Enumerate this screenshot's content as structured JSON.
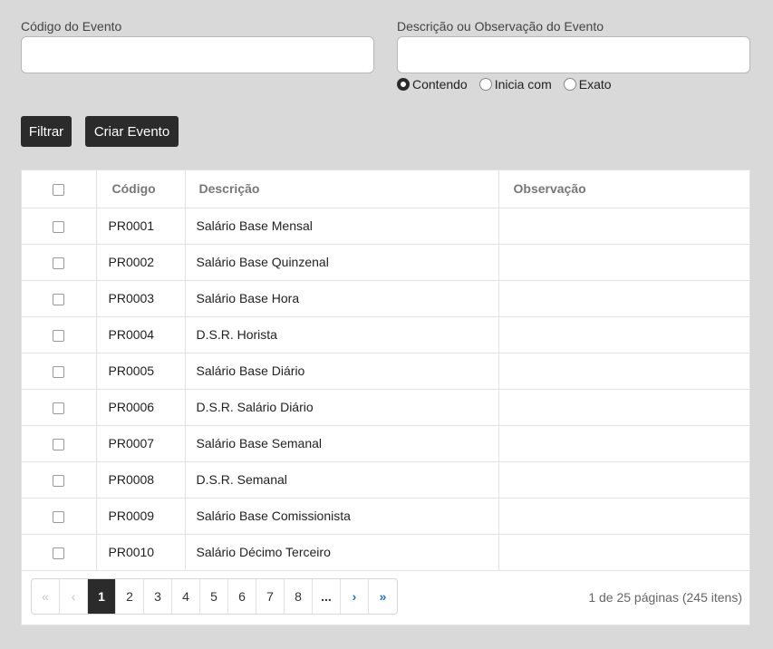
{
  "filters": {
    "code_label": "Código do Evento",
    "code_value": "",
    "desc_label": "Descrição ou Observação do Evento",
    "desc_value": "",
    "match_options": [
      {
        "label": "Contendo",
        "checked": true
      },
      {
        "label": "Inicia com",
        "checked": false
      },
      {
        "label": "Exato",
        "checked": false
      }
    ]
  },
  "buttons": {
    "filter_label": "Filtrar",
    "create_label": "Criar Evento"
  },
  "table": {
    "headers": {
      "code": "Código",
      "description": "Descrição",
      "observation": "Observação"
    },
    "rows": [
      {
        "code": "PR0001",
        "description": "Salário Base Mensal",
        "observation": ""
      },
      {
        "code": "PR0002",
        "description": "Salário Base Quinzenal",
        "observation": ""
      },
      {
        "code": "PR0003",
        "description": "Salário Base Hora",
        "observation": ""
      },
      {
        "code": "PR0004",
        "description": "D.S.R. Horista",
        "observation": ""
      },
      {
        "code": "PR0005",
        "description": "Salário Base Diário",
        "observation": ""
      },
      {
        "code": "PR0006",
        "description": "D.S.R. Salário Diário",
        "observation": ""
      },
      {
        "code": "PR0007",
        "description": "Salário Base Semanal",
        "observation": ""
      },
      {
        "code": "PR0008",
        "description": "D.S.R. Semanal",
        "observation": ""
      },
      {
        "code": "PR0009",
        "description": "Salário Base Comissionista",
        "observation": ""
      },
      {
        "code": "PR0010",
        "description": "Salário Décimo Terceiro",
        "observation": ""
      }
    ]
  },
  "pagination": {
    "first": "«",
    "prev": "‹",
    "pages": [
      "1",
      "2",
      "3",
      "4",
      "5",
      "6",
      "7",
      "8"
    ],
    "current": "1",
    "ellipsis": "...",
    "next": "›",
    "last": "»",
    "info": "1 de 25 páginas (245 itens)"
  },
  "colors": {
    "background": "#d9d9d9",
    "button": "#2b2b2b",
    "link_blue": "#1a73c8"
  }
}
